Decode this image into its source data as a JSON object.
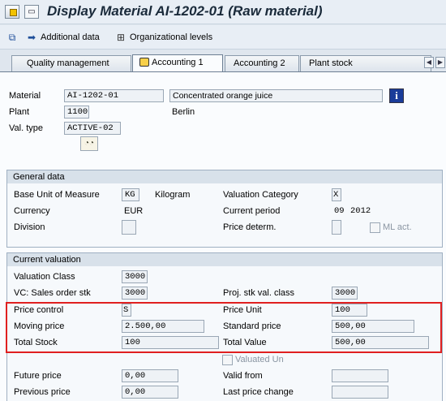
{
  "window": {
    "title": "Display Material AI-1202-01 (Raw material)",
    "menu_icon": "page-menu-icon",
    "app_icon": "sap-window-icon"
  },
  "toolbar": {
    "additional_data": "Additional data",
    "org_levels": "Organizational levels",
    "additional_data_icon": "arrow-right-icon",
    "org_levels_icon": "org-tree-icon",
    "first_icon": "copy-screen-icon"
  },
  "tabs": [
    {
      "label": "Quality management"
    },
    {
      "label": "Accounting 1"
    },
    {
      "label": "Accounting 2"
    },
    {
      "label": "Plant stock"
    }
  ],
  "header": {
    "material_label": "Material",
    "material_value": "AI-1202-01",
    "material_desc": "Concentrated orange juice",
    "plant_label": "Plant",
    "plant_value": "1100",
    "plant_name": "Berlin",
    "val_type_label": "Val. type",
    "val_type_value": "ACTIVE-02",
    "info_icon": "info-icon",
    "detail_icon": "glasses-icon"
  },
  "general": {
    "title": "General data",
    "base_uom_label": "Base Unit of Measure",
    "base_uom_value": "KG",
    "base_uom_text": "Kilogram",
    "currency_label": "Currency",
    "currency_value": "EUR",
    "division_label": "Division",
    "division_value": "",
    "valuation_category_label": "Valuation Category",
    "valuation_category_value": "X",
    "current_period_label": "Current period",
    "current_period_month": "09",
    "current_period_year": "2012",
    "price_determ_label": "Price determ.",
    "price_determ_value": "",
    "ml_act_label": "ML act."
  },
  "valuation": {
    "title": "Current valuation",
    "valuation_class_label": "Valuation Class",
    "valuation_class_value": "3000",
    "vc_sales_label": "VC: Sales order stk",
    "vc_sales_value": "3000",
    "proj_stk_label": "Proj. stk val. class",
    "proj_stk_value": "3000",
    "price_control_label": "Price control",
    "price_control_value": "S",
    "price_unit_label": "Price Unit",
    "price_unit_value": "100",
    "moving_price_label": "Moving price",
    "moving_price_value": "2.500,00",
    "standard_price_label": "Standard price",
    "standard_price_value": "500,00",
    "total_stock_label": "Total Stock",
    "total_stock_value": "100",
    "total_value_label": "Total Value",
    "total_value_value": "500,00",
    "valuated_un_label": "Valuated Un",
    "future_price_label": "Future price",
    "future_price_value": "0,00",
    "valid_from_label": "Valid from",
    "valid_from_value": "",
    "previous_price_label": "Previous price",
    "previous_price_value": "0,00",
    "last_price_change_label": "Last price change",
    "last_price_change_value": ""
  },
  "colors": {
    "highlight_border": "#e02020",
    "info_button": "#1a3c9a"
  }
}
